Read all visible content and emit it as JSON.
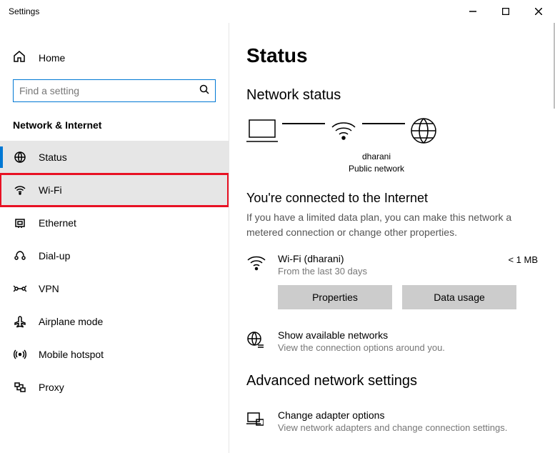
{
  "titlebar": {
    "title": "Settings"
  },
  "sidebar": {
    "home": "Home",
    "search_placeholder": "Find a setting",
    "category": "Network & Internet",
    "items": [
      {
        "label": "Status"
      },
      {
        "label": "Wi-Fi"
      },
      {
        "label": "Ethernet"
      },
      {
        "label": "Dial-up"
      },
      {
        "label": "VPN"
      },
      {
        "label": "Airplane mode"
      },
      {
        "label": "Mobile hotspot"
      },
      {
        "label": "Proxy"
      }
    ]
  },
  "main": {
    "heading": "Status",
    "section": "Network status",
    "diagram": {
      "name": "dharani",
      "type": "Public network"
    },
    "connected": {
      "title": "You're connected to the Internet",
      "desc": "If you have a limited data plan, you can make this network a metered connection or change other properties."
    },
    "connection": {
      "name": "Wi-Fi (dharani)",
      "period": "From the last 30 days",
      "usage": "< 1 MB",
      "properties_btn": "Properties",
      "datausage_btn": "Data usage"
    },
    "available": {
      "title": "Show available networks",
      "sub": "View the connection options around you."
    },
    "advanced": {
      "heading": "Advanced network settings",
      "adapter": {
        "title": "Change adapter options",
        "sub": "View network adapters and change connection settings."
      }
    }
  }
}
